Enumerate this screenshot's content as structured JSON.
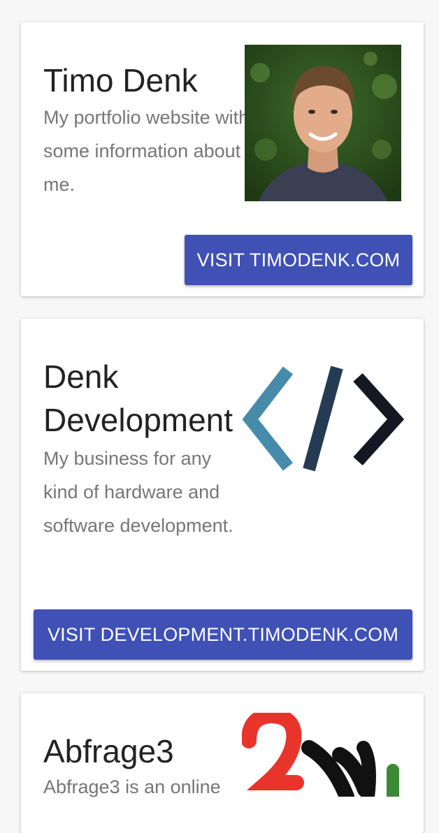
{
  "cards": [
    {
      "title": "Timo Denk",
      "description": "My portfolio website with some information about me.",
      "button": "VISIT TIMODENK.COM"
    },
    {
      "title": "Denk Development",
      "description": "My business for any kind of hardware and software development.",
      "button": "VISIT DEVELOPMENT.TIMODENK.COM",
      "logo_colors": [
        "#468caa",
        "#253b54",
        "#151822"
      ]
    },
    {
      "title": "Abfrage3",
      "description": "Abfrage3 is an online"
    }
  ],
  "accent_color": "#3f51b5"
}
